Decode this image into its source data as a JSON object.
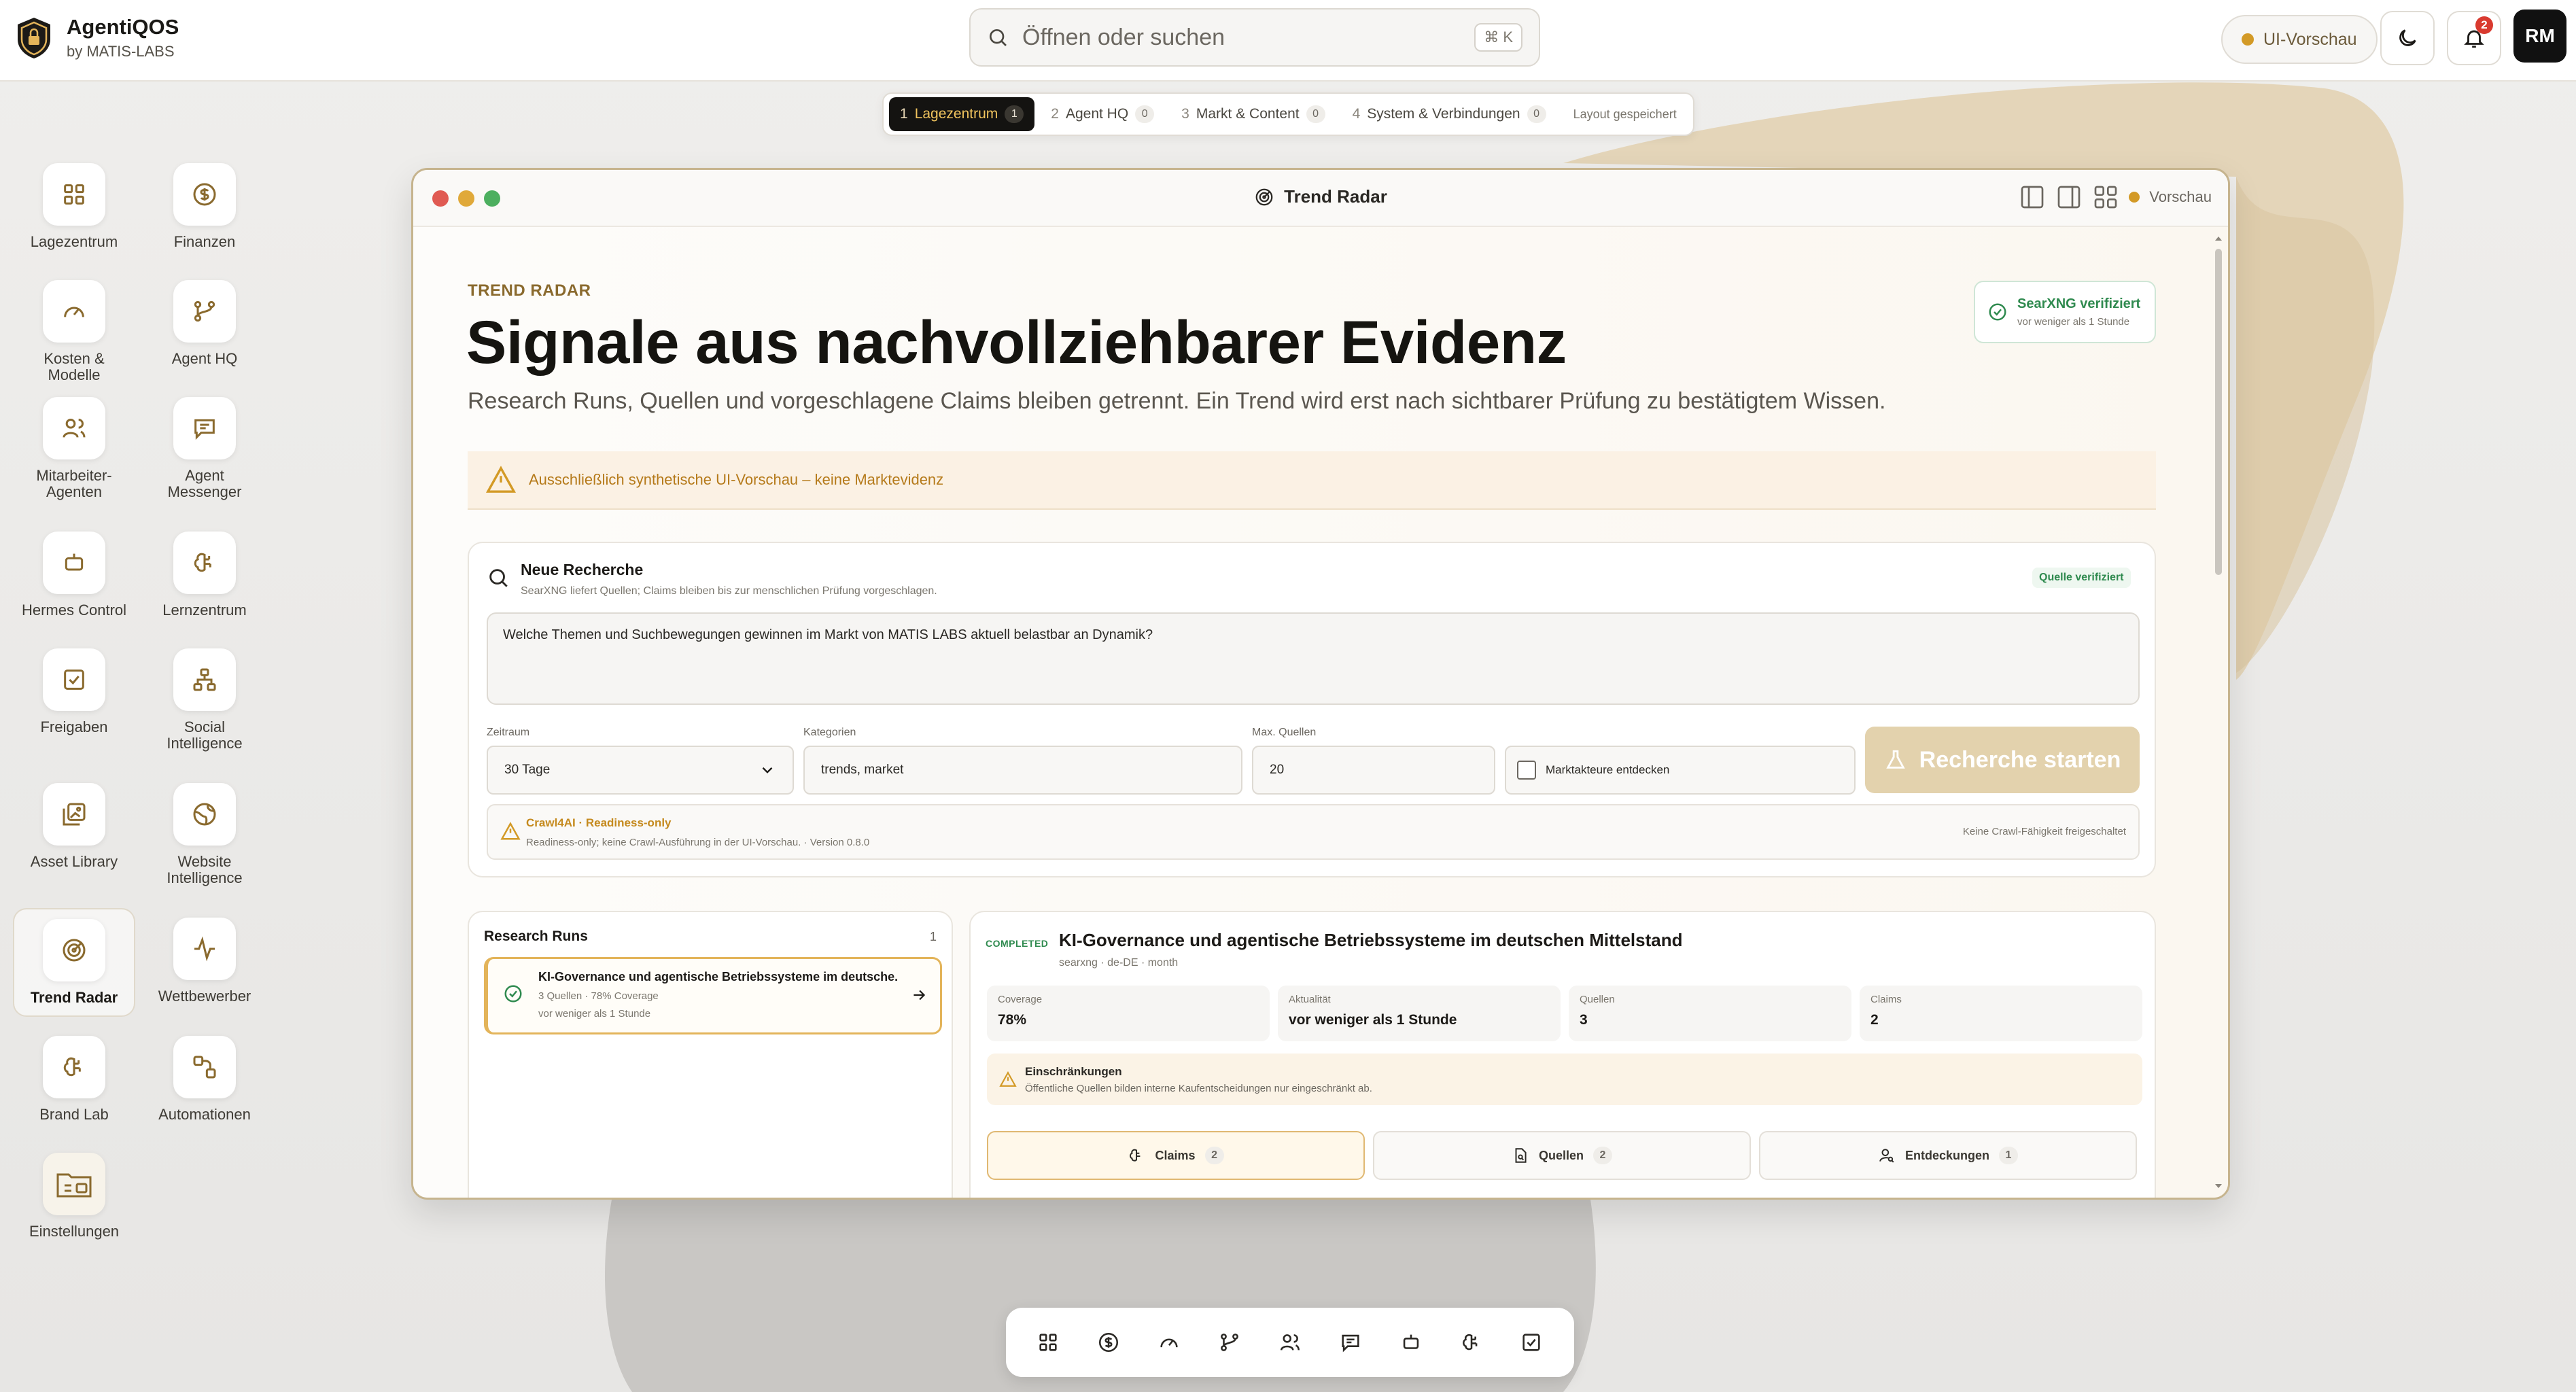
{
  "app": {
    "name": "AgentiQOS",
    "by": "by MATIS-LABS"
  },
  "search": {
    "placeholder": "Öffnen oder suchen",
    "shortcut": "⌘ K"
  },
  "header": {
    "preview_pill": "UI-Vorschau",
    "notification_count": "2",
    "avatar_initials": "RM"
  },
  "workspace_tabs": [
    {
      "num": "1",
      "label": "Lagezentrum",
      "count": "1",
      "active": true
    },
    {
      "num": "2",
      "label": "Agent HQ",
      "count": "0"
    },
    {
      "num": "3",
      "label": "Markt & Content",
      "count": "0"
    },
    {
      "num": "4",
      "label": "System & Verbindungen",
      "count": "0"
    }
  ],
  "layout_saved": "Layout gespeichert",
  "launcher": [
    {
      "label": "Lagezentrum",
      "icon": "grid-icon"
    },
    {
      "label": "Finanzen",
      "icon": "dollar-icon"
    },
    {
      "label": "Kosten & Modelle",
      "icon": "gauge-icon"
    },
    {
      "label": "Agent HQ",
      "icon": "git-branch-icon"
    },
    {
      "label": "Mitarbeiter-Agenten",
      "icon": "users-icon"
    },
    {
      "label": "Agent Messenger",
      "icon": "message-icon"
    },
    {
      "label": "Hermes Control",
      "icon": "bot-icon"
    },
    {
      "label": "Lernzentrum",
      "icon": "brain-icon"
    },
    {
      "label": "Freigaben",
      "icon": "check-square-icon"
    },
    {
      "label": "Social Intelligence",
      "icon": "network-icon"
    },
    {
      "label": "Asset Library",
      "icon": "images-icon"
    },
    {
      "label": "Website Intelligence",
      "icon": "globe-icon"
    },
    {
      "label": "Trend Radar",
      "icon": "radar-icon",
      "selected": true
    },
    {
      "label": "Wettbewerber",
      "icon": "activity-icon"
    },
    {
      "label": "Brand Lab",
      "icon": "brain-icon"
    },
    {
      "label": "Automationen",
      "icon": "workflow-icon"
    },
    {
      "label": "Einstellungen",
      "icon": "folder-settings-icon"
    }
  ],
  "window": {
    "title": "Trend Radar",
    "preview": "Vorschau"
  },
  "page": {
    "eyebrow": "TREND RADAR",
    "title": "Signale aus nachvollziehbarer Evidenz",
    "lead": "Research Runs, Quellen und vorgeschlagene Claims bleiben getrennt. Ein Trend wird erst nach sichtbarer Prüfung zu bestätigtem Wissen.",
    "verified_title": "SearXNG verifiziert",
    "verified_sub": "vor weniger als 1 Stunde",
    "warning": "Ausschließlich synthetische UI-Vorschau – keine Marktevidenz"
  },
  "research": {
    "title": "Neue Recherche",
    "subtitle": "SearXNG liefert Quellen; Claims bleiben bis zur menschlichen Prüfung vorgeschlagen.",
    "badge": "Quelle verifiziert",
    "question": "Welche Themen und Suchbewegungen gewinnen im Markt von MATIS LABS aktuell belastbar an Dynamik?",
    "zeitraum_label": "Zeitraum",
    "zeitraum_value": "30 Tage",
    "kategorien_label": "Kategorien",
    "kategorien_value": "trends, market",
    "max_label": "Max. Quellen",
    "max_value": "20",
    "checkbox_label": "Marktakteure entdecken",
    "start_button": "Recherche starten",
    "crawl_title": "Crawl4AI · Readiness-only",
    "crawl_sub": "Readiness-only; keine Crawl-Ausführung in der UI-Vorschau. · Version 0.8.0",
    "crawl_right": "Keine Crawl-Fähigkeit freigeschaltet"
  },
  "runs": {
    "title": "Research Runs",
    "count": "1",
    "items": [
      {
        "title": "KI-Governance und agentische Betriebssysteme im deutsche...",
        "meta": "3 Quellen · 78% Coverage",
        "time": "vor weniger als 1 Stunde"
      }
    ]
  },
  "detail": {
    "status": "COMPLETED",
    "title": "KI-Governance und agentische Betriebssysteme im deutschen Mittelstand",
    "meta": "searxng · de-DE · month",
    "stats": [
      {
        "label": "Coverage",
        "value": "78%"
      },
      {
        "label": "Aktualität",
        "value": "vor weniger als 1 Stunde"
      },
      {
        "label": "Quellen",
        "value": "3"
      },
      {
        "label": "Claims",
        "value": "2"
      }
    ],
    "limits_title": "Einschränkungen",
    "limits_text": "Öffentliche Quellen bilden interne Kaufentscheidungen nur eingeschränkt ab.",
    "tabs": [
      {
        "label": "Claims",
        "count": "2",
        "active": true
      },
      {
        "label": "Quellen",
        "count": "2"
      },
      {
        "label": "Entdeckungen",
        "count": "1"
      }
    ]
  },
  "colors": {
    "accent": "#c9953a",
    "accent_dark": "#8a6a2e",
    "success": "#2f8a4f",
    "warning": "#d39a26",
    "danger": "#d93a2f"
  }
}
